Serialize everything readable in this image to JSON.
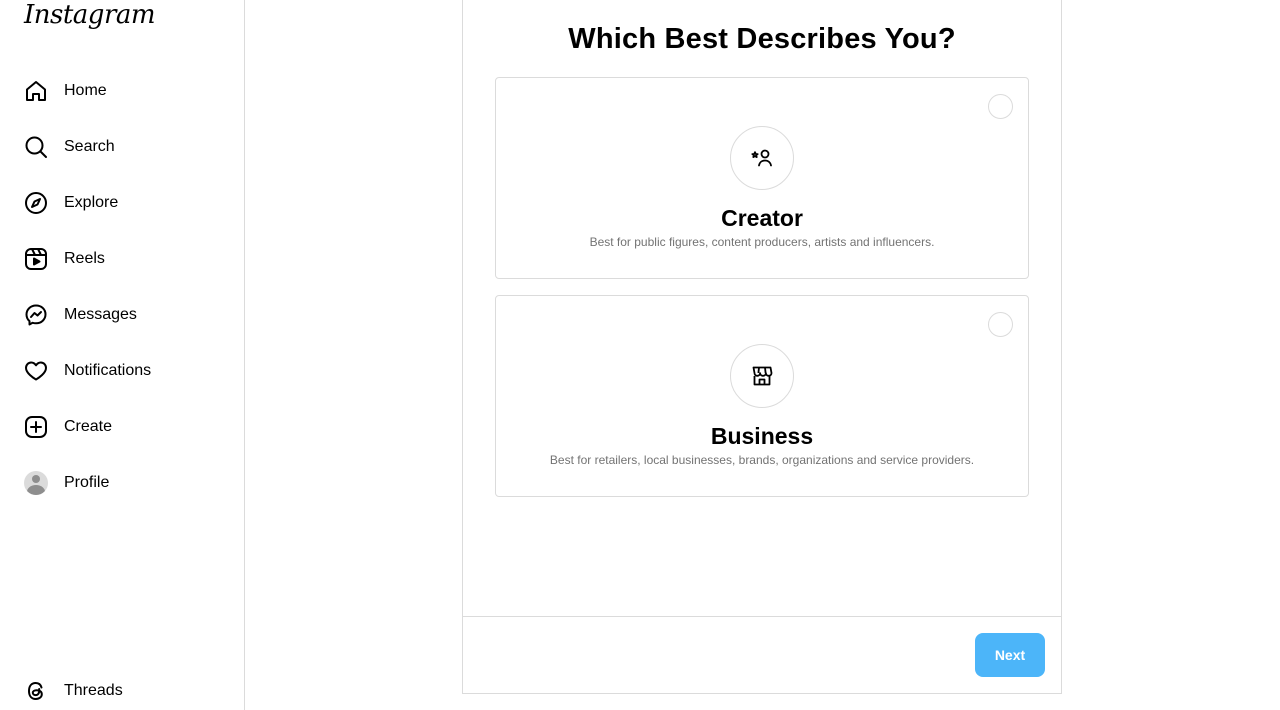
{
  "app": {
    "logo_text": "Instagram"
  },
  "sidebar": {
    "items": [
      {
        "label": "Home",
        "icon": "home-icon"
      },
      {
        "label": "Search",
        "icon": "search-icon"
      },
      {
        "label": "Explore",
        "icon": "compass-icon"
      },
      {
        "label": "Reels",
        "icon": "reels-icon"
      },
      {
        "label": "Messages",
        "icon": "messenger-icon"
      },
      {
        "label": "Notifications",
        "icon": "heart-icon"
      },
      {
        "label": "Create",
        "icon": "plus-square-icon"
      },
      {
        "label": "Profile",
        "icon": "avatar"
      }
    ],
    "bottom": {
      "label": "Threads",
      "icon": "threads-icon"
    }
  },
  "main": {
    "title": "Which Best Describes You?",
    "options": [
      {
        "title": "Creator",
        "description": "Best for public figures, content producers, artists and influencers.",
        "icon": "creator-icon",
        "selected": false
      },
      {
        "title": "Business",
        "description": "Best for retailers, local businesses, brands, organizations and service providers.",
        "icon": "storefront-icon",
        "selected": false
      }
    ],
    "next_label": "Next"
  },
  "colors": {
    "accent": "#4cb5f9",
    "border": "#dbdbdb",
    "muted_text": "#737373"
  }
}
